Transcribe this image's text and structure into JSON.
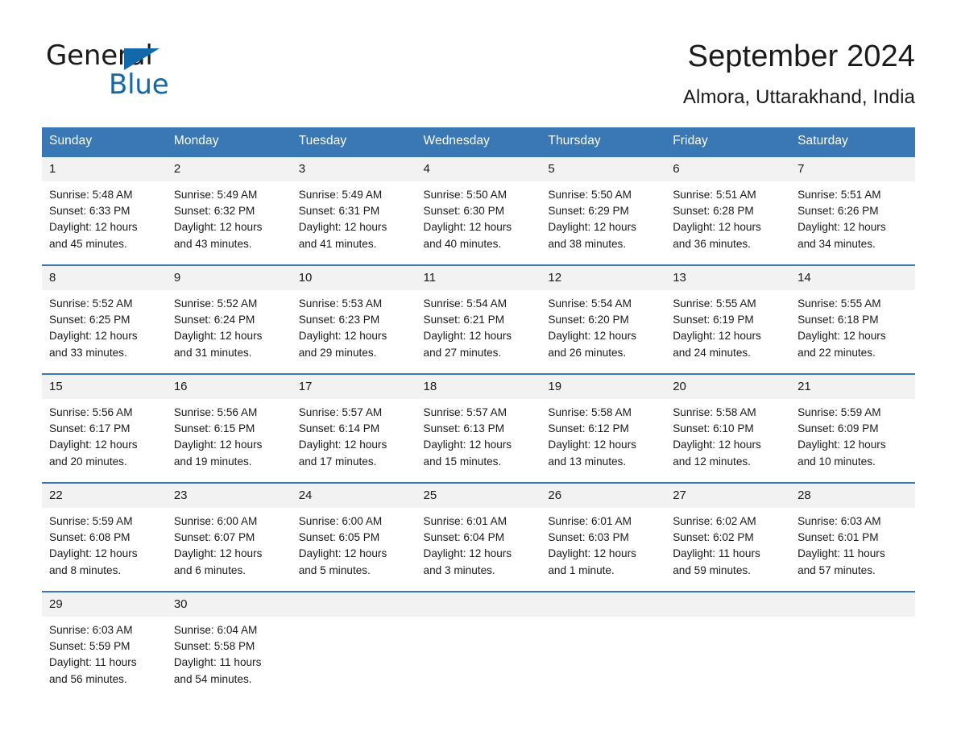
{
  "brand": {
    "name_part1": "General",
    "name_part2": "Blue",
    "triangle_icon": "brand-triangle-icon",
    "accent_color": "#1169ab"
  },
  "header": {
    "title": "September 2024",
    "location": "Almora, Uttarakhand, India"
  },
  "theme": {
    "header_row_bg": "#3a78b5",
    "header_row_text": "#ffffff",
    "daynum_bg": "#f2f2f2",
    "row_divider": "#3a78b5",
    "page_bg": "#ffffff",
    "text": "#1a1a1a"
  },
  "weekday_headers": [
    "Sunday",
    "Monday",
    "Tuesday",
    "Wednesday",
    "Thursday",
    "Friday",
    "Saturday"
  ],
  "labels": {
    "sunrise_prefix": "Sunrise:",
    "sunset_prefix": "Sunset:",
    "daylight_prefix": "Daylight:"
  },
  "weeks": [
    [
      {
        "day": "1",
        "sunrise": "Sunrise: 5:48 AM",
        "sunset": "Sunset: 6:33 PM",
        "daylight_line1": "Daylight: 12 hours",
        "daylight_line2": "and 45 minutes."
      },
      {
        "day": "2",
        "sunrise": "Sunrise: 5:49 AM",
        "sunset": "Sunset: 6:32 PM",
        "daylight_line1": "Daylight: 12 hours",
        "daylight_line2": "and 43 minutes."
      },
      {
        "day": "3",
        "sunrise": "Sunrise: 5:49 AM",
        "sunset": "Sunset: 6:31 PM",
        "daylight_line1": "Daylight: 12 hours",
        "daylight_line2": "and 41 minutes."
      },
      {
        "day": "4",
        "sunrise": "Sunrise: 5:50 AM",
        "sunset": "Sunset: 6:30 PM",
        "daylight_line1": "Daylight: 12 hours",
        "daylight_line2": "and 40 minutes."
      },
      {
        "day": "5",
        "sunrise": "Sunrise: 5:50 AM",
        "sunset": "Sunset: 6:29 PM",
        "daylight_line1": "Daylight: 12 hours",
        "daylight_line2": "and 38 minutes."
      },
      {
        "day": "6",
        "sunrise": "Sunrise: 5:51 AM",
        "sunset": "Sunset: 6:28 PM",
        "daylight_line1": "Daylight: 12 hours",
        "daylight_line2": "and 36 minutes."
      },
      {
        "day": "7",
        "sunrise": "Sunrise: 5:51 AM",
        "sunset": "Sunset: 6:26 PM",
        "daylight_line1": "Daylight: 12 hours",
        "daylight_line2": "and 34 minutes."
      }
    ],
    [
      {
        "day": "8",
        "sunrise": "Sunrise: 5:52 AM",
        "sunset": "Sunset: 6:25 PM",
        "daylight_line1": "Daylight: 12 hours",
        "daylight_line2": "and 33 minutes."
      },
      {
        "day": "9",
        "sunrise": "Sunrise: 5:52 AM",
        "sunset": "Sunset: 6:24 PM",
        "daylight_line1": "Daylight: 12 hours",
        "daylight_line2": "and 31 minutes."
      },
      {
        "day": "10",
        "sunrise": "Sunrise: 5:53 AM",
        "sunset": "Sunset: 6:23 PM",
        "daylight_line1": "Daylight: 12 hours",
        "daylight_line2": "and 29 minutes."
      },
      {
        "day": "11",
        "sunrise": "Sunrise: 5:54 AM",
        "sunset": "Sunset: 6:21 PM",
        "daylight_line1": "Daylight: 12 hours",
        "daylight_line2": "and 27 minutes."
      },
      {
        "day": "12",
        "sunrise": "Sunrise: 5:54 AM",
        "sunset": "Sunset: 6:20 PM",
        "daylight_line1": "Daylight: 12 hours",
        "daylight_line2": "and 26 minutes."
      },
      {
        "day": "13",
        "sunrise": "Sunrise: 5:55 AM",
        "sunset": "Sunset: 6:19 PM",
        "daylight_line1": "Daylight: 12 hours",
        "daylight_line2": "and 24 minutes."
      },
      {
        "day": "14",
        "sunrise": "Sunrise: 5:55 AM",
        "sunset": "Sunset: 6:18 PM",
        "daylight_line1": "Daylight: 12 hours",
        "daylight_line2": "and 22 minutes."
      }
    ],
    [
      {
        "day": "15",
        "sunrise": "Sunrise: 5:56 AM",
        "sunset": "Sunset: 6:17 PM",
        "daylight_line1": "Daylight: 12 hours",
        "daylight_line2": "and 20 minutes."
      },
      {
        "day": "16",
        "sunrise": "Sunrise: 5:56 AM",
        "sunset": "Sunset: 6:15 PM",
        "daylight_line1": "Daylight: 12 hours",
        "daylight_line2": "and 19 minutes."
      },
      {
        "day": "17",
        "sunrise": "Sunrise: 5:57 AM",
        "sunset": "Sunset: 6:14 PM",
        "daylight_line1": "Daylight: 12 hours",
        "daylight_line2": "and 17 minutes."
      },
      {
        "day": "18",
        "sunrise": "Sunrise: 5:57 AM",
        "sunset": "Sunset: 6:13 PM",
        "daylight_line1": "Daylight: 12 hours",
        "daylight_line2": "and 15 minutes."
      },
      {
        "day": "19",
        "sunrise": "Sunrise: 5:58 AM",
        "sunset": "Sunset: 6:12 PM",
        "daylight_line1": "Daylight: 12 hours",
        "daylight_line2": "and 13 minutes."
      },
      {
        "day": "20",
        "sunrise": "Sunrise: 5:58 AM",
        "sunset": "Sunset: 6:10 PM",
        "daylight_line1": "Daylight: 12 hours",
        "daylight_line2": "and 12 minutes."
      },
      {
        "day": "21",
        "sunrise": "Sunrise: 5:59 AM",
        "sunset": "Sunset: 6:09 PM",
        "daylight_line1": "Daylight: 12 hours",
        "daylight_line2": "and 10 minutes."
      }
    ],
    [
      {
        "day": "22",
        "sunrise": "Sunrise: 5:59 AM",
        "sunset": "Sunset: 6:08 PM",
        "daylight_line1": "Daylight: 12 hours",
        "daylight_line2": "and 8 minutes."
      },
      {
        "day": "23",
        "sunrise": "Sunrise: 6:00 AM",
        "sunset": "Sunset: 6:07 PM",
        "daylight_line1": "Daylight: 12 hours",
        "daylight_line2": "and 6 minutes."
      },
      {
        "day": "24",
        "sunrise": "Sunrise: 6:00 AM",
        "sunset": "Sunset: 6:05 PM",
        "daylight_line1": "Daylight: 12 hours",
        "daylight_line2": "and 5 minutes."
      },
      {
        "day": "25",
        "sunrise": "Sunrise: 6:01 AM",
        "sunset": "Sunset: 6:04 PM",
        "daylight_line1": "Daylight: 12 hours",
        "daylight_line2": "and 3 minutes."
      },
      {
        "day": "26",
        "sunrise": "Sunrise: 6:01 AM",
        "sunset": "Sunset: 6:03 PM",
        "daylight_line1": "Daylight: 12 hours",
        "daylight_line2": "and 1 minute."
      },
      {
        "day": "27",
        "sunrise": "Sunrise: 6:02 AM",
        "sunset": "Sunset: 6:02 PM",
        "daylight_line1": "Daylight: 11 hours",
        "daylight_line2": "and 59 minutes."
      },
      {
        "day": "28",
        "sunrise": "Sunrise: 6:03 AM",
        "sunset": "Sunset: 6:01 PM",
        "daylight_line1": "Daylight: 11 hours",
        "daylight_line2": "and 57 minutes."
      }
    ],
    [
      {
        "day": "29",
        "sunrise": "Sunrise: 6:03 AM",
        "sunset": "Sunset: 5:59 PM",
        "daylight_line1": "Daylight: 11 hours",
        "daylight_line2": "and 56 minutes."
      },
      {
        "day": "30",
        "sunrise": "Sunrise: 6:04 AM",
        "sunset": "Sunset: 5:58 PM",
        "daylight_line1": "Daylight: 11 hours",
        "daylight_line2": "and 54 minutes."
      },
      {
        "day": "",
        "sunrise": "",
        "sunset": "",
        "daylight_line1": "",
        "daylight_line2": "",
        "blank": true
      },
      {
        "day": "",
        "sunrise": "",
        "sunset": "",
        "daylight_line1": "",
        "daylight_line2": "",
        "blank": true
      },
      {
        "day": "",
        "sunrise": "",
        "sunset": "",
        "daylight_line1": "",
        "daylight_line2": "",
        "blank": true
      },
      {
        "day": "",
        "sunrise": "",
        "sunset": "",
        "daylight_line1": "",
        "daylight_line2": "",
        "blank": true
      },
      {
        "day": "",
        "sunrise": "",
        "sunset": "",
        "daylight_line1": "",
        "daylight_line2": "",
        "blank": true
      }
    ]
  ]
}
